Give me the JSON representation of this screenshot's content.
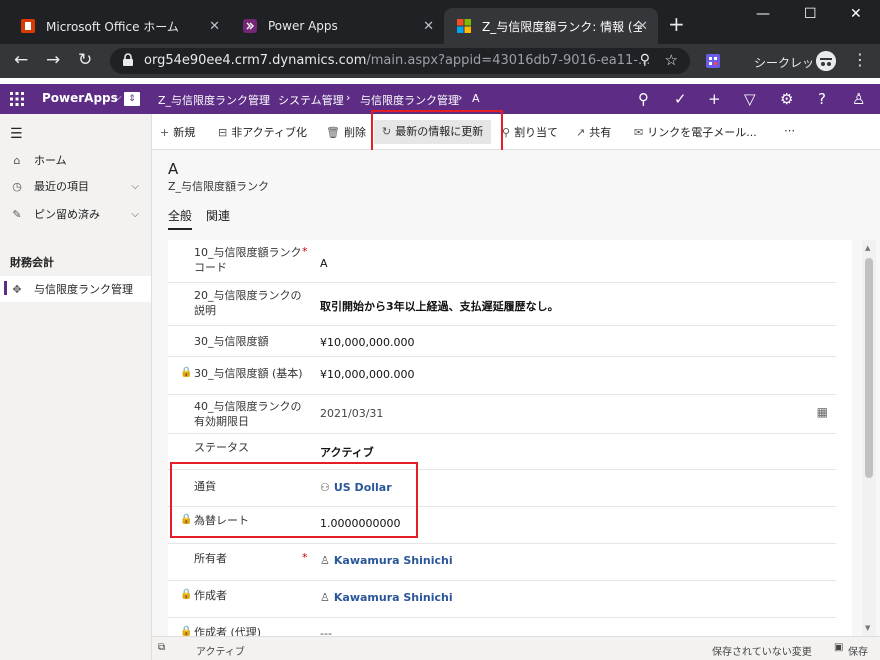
{
  "browser": {
    "tabs": [
      {
        "title": "Microsoft Office ホーム"
      },
      {
        "title": "Power Apps"
      },
      {
        "title": "Z_与信限度額ランク: 情報 (全"
      }
    ],
    "url_host": "org54e90ee4.crm7.dynamics.com",
    "url_path": "/main.aspx?appid=43016db7-9016-ea11-...",
    "incognito_label": "シークレット"
  },
  "appbar": {
    "brand": "PowerApps",
    "app_name": "Z_与信限度ランク管理",
    "breadcrumbs": [
      "システム管理",
      "与信限度ランク管理",
      "A"
    ]
  },
  "sidebar": {
    "items": [
      {
        "label": "ホーム"
      },
      {
        "label": "最近の項目"
      },
      {
        "label": "ピン留め済み"
      }
    ],
    "group_title": "財務会計",
    "group_items": [
      {
        "label": "与信限度ランク管理"
      }
    ]
  },
  "commands": {
    "new": "新規",
    "deactivate": "非アクティブ化",
    "delete": "削除",
    "refresh": "最新の情報に更新",
    "assign": "割り当て",
    "share": "共有",
    "email_link": "リンクを電子メール...",
    "more": "⋯"
  },
  "record": {
    "title": "A",
    "entity": "Z_与信限度額ランク",
    "tabs": [
      "全般",
      "関連"
    ]
  },
  "fields": {
    "rank_code": {
      "label": "10_与信限度額ランクコード",
      "value": "A"
    },
    "rank_desc": {
      "label": "20_与信限度ランクの説明",
      "value": "取引開始から3年以上経過、支払遅延履歴なし。"
    },
    "credit_limit": {
      "label": "30_与信限度額",
      "value": "¥10,000,000.000"
    },
    "credit_limit_base": {
      "label": "30_与信限度額 (基本)",
      "value": "¥10,000,000.000"
    },
    "expiry": {
      "label": "40_与信限度ランクの有効期限日",
      "value": "2021/03/31"
    },
    "status": {
      "label": "ステータス",
      "value": "アクティブ"
    },
    "currency": {
      "label": "通貨",
      "value": "US Dollar"
    },
    "exchange_rate": {
      "label": "為替レート",
      "value": "1.0000000000"
    },
    "owner": {
      "label": "所有者",
      "value": "Kawamura Shinichi"
    },
    "created_by": {
      "label": "作成者",
      "value": "Kawamura Shinichi"
    },
    "created_by_delegate": {
      "label": "作成者 (代理)",
      "value": "---"
    }
  },
  "footer": {
    "status": "アクティブ",
    "unsaved": "保存されていない変更",
    "save": "保存"
  },
  "colors": {
    "app_header": "#5d2d85",
    "highlight": "#e31e24",
    "link": "#2b579a"
  }
}
